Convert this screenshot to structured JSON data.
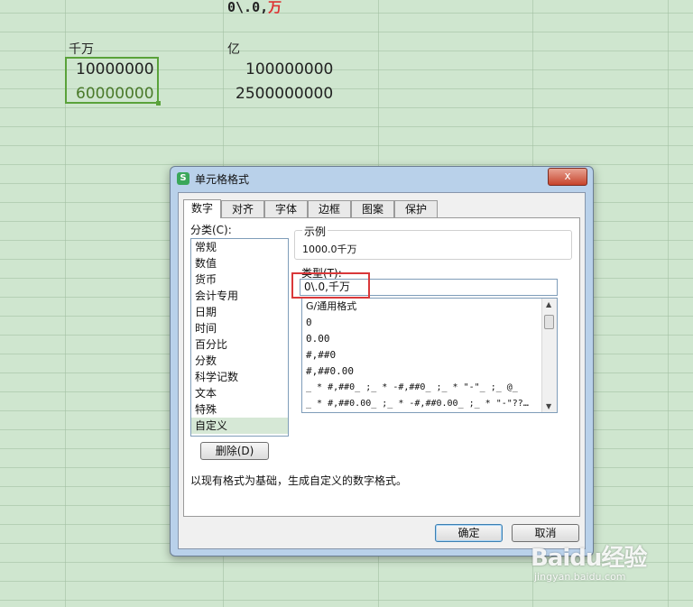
{
  "sheet": {
    "format_text_a": "0\\.0,",
    "format_text_b": "万",
    "header_left": "千万",
    "header_right": "亿",
    "rows": [
      {
        "left": "10000000",
        "right": "100000000"
      },
      {
        "left": "60000000",
        "right": "2500000000"
      }
    ]
  },
  "dialog": {
    "title": "单元格格式",
    "close_label": "x",
    "tabs": [
      "数字",
      "对齐",
      "字体",
      "边框",
      "图案",
      "保护"
    ],
    "category_label": "分类(C):",
    "categories": [
      "常规",
      "数值",
      "货币",
      "会计专用",
      "日期",
      "时间",
      "百分比",
      "分数",
      "科学记数",
      "文本",
      "特殊",
      "自定义"
    ],
    "selected_category": "自定义",
    "sample_label": "示例",
    "sample_value": "1000.0千万",
    "type_label": "类型(T):",
    "type_value": "0\\.0,千万",
    "formats": [
      "G/通用格式",
      "0",
      "0.00",
      "#,##0",
      "#,##0.00",
      "_ * #,##0_ ;_ * -#,##0_ ;_ * \"-\"_ ;_ @_",
      "_ * #,##0.00_ ;_ * -#,##0.00_ ;_ * \"-\"??…"
    ],
    "delete_label": "删除(D)",
    "description": "以现有格式为基础，生成自定义的数字格式。",
    "ok_label": "确定",
    "cancel_label": "取消"
  },
  "watermark": {
    "logo": "Baidu经验",
    "sub": "jingyan.baidu.com"
  },
  "colors": {
    "selection": "#5aa23a",
    "highlight": "#d9383a",
    "sheet_bg": "#cfe6cf"
  }
}
